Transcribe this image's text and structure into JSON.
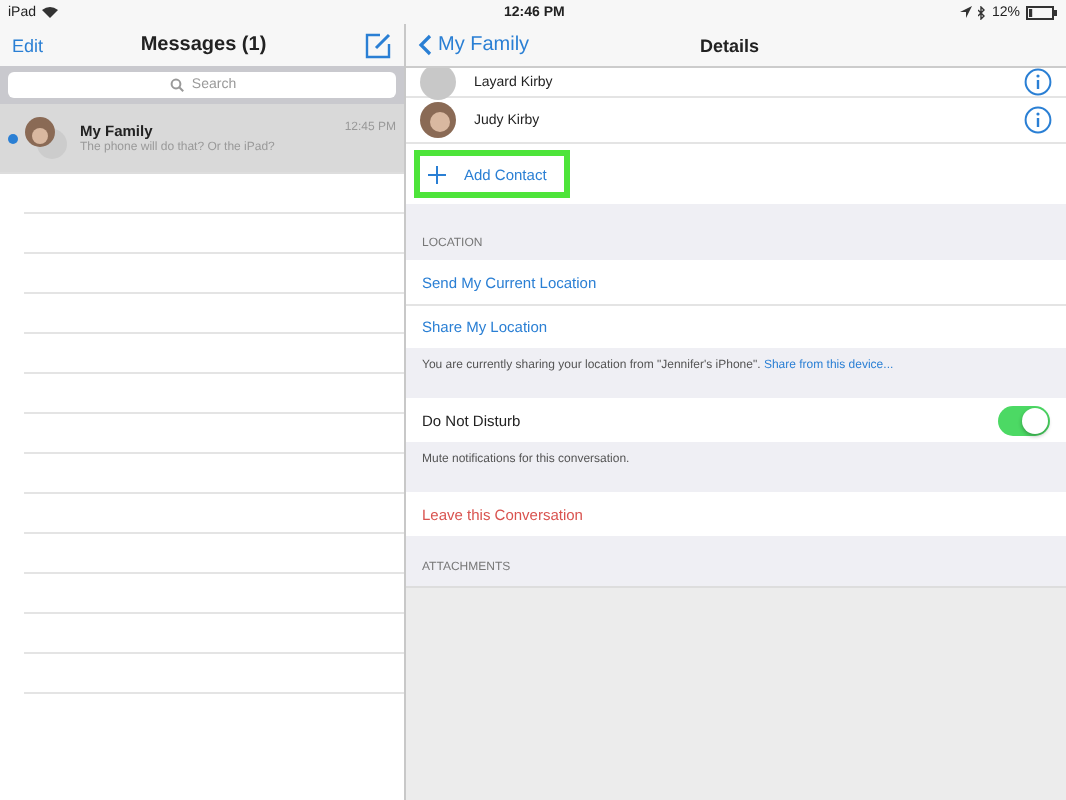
{
  "status_bar": {
    "device": "iPad",
    "time": "12:46 PM",
    "battery": "12%"
  },
  "master": {
    "edit": "Edit",
    "title": "Messages (1)",
    "search": {
      "placeholder": "Search"
    },
    "conversations": [
      {
        "name": "My Family",
        "preview": "The phone will do that? Or the iPad?",
        "time": "12:45 PM",
        "selected": true,
        "unread": true
      }
    ]
  },
  "detail": {
    "back": "My Family",
    "title": "Details",
    "contacts": [
      {
        "name": "Layard Kirby",
        "photo": false
      },
      {
        "name": "Judy Kirby",
        "photo": true
      }
    ],
    "add_contact": {
      "label": "Add Contact",
      "highlighted": true
    },
    "location": {
      "header": "LOCATION",
      "actions": [
        "Send My Current Location",
        "Share My Location"
      ],
      "footer": "You are currently sharing your location from \"Jennifer's iPhone\".",
      "footer_link": "Share from this device..."
    },
    "do_not_disturb": {
      "label": "Do Not Disturb",
      "on": true,
      "footer": "Mute notifications for this conversation."
    },
    "leave": "Leave this Conversation",
    "attachments_header": "ATTACHMENTS"
  }
}
